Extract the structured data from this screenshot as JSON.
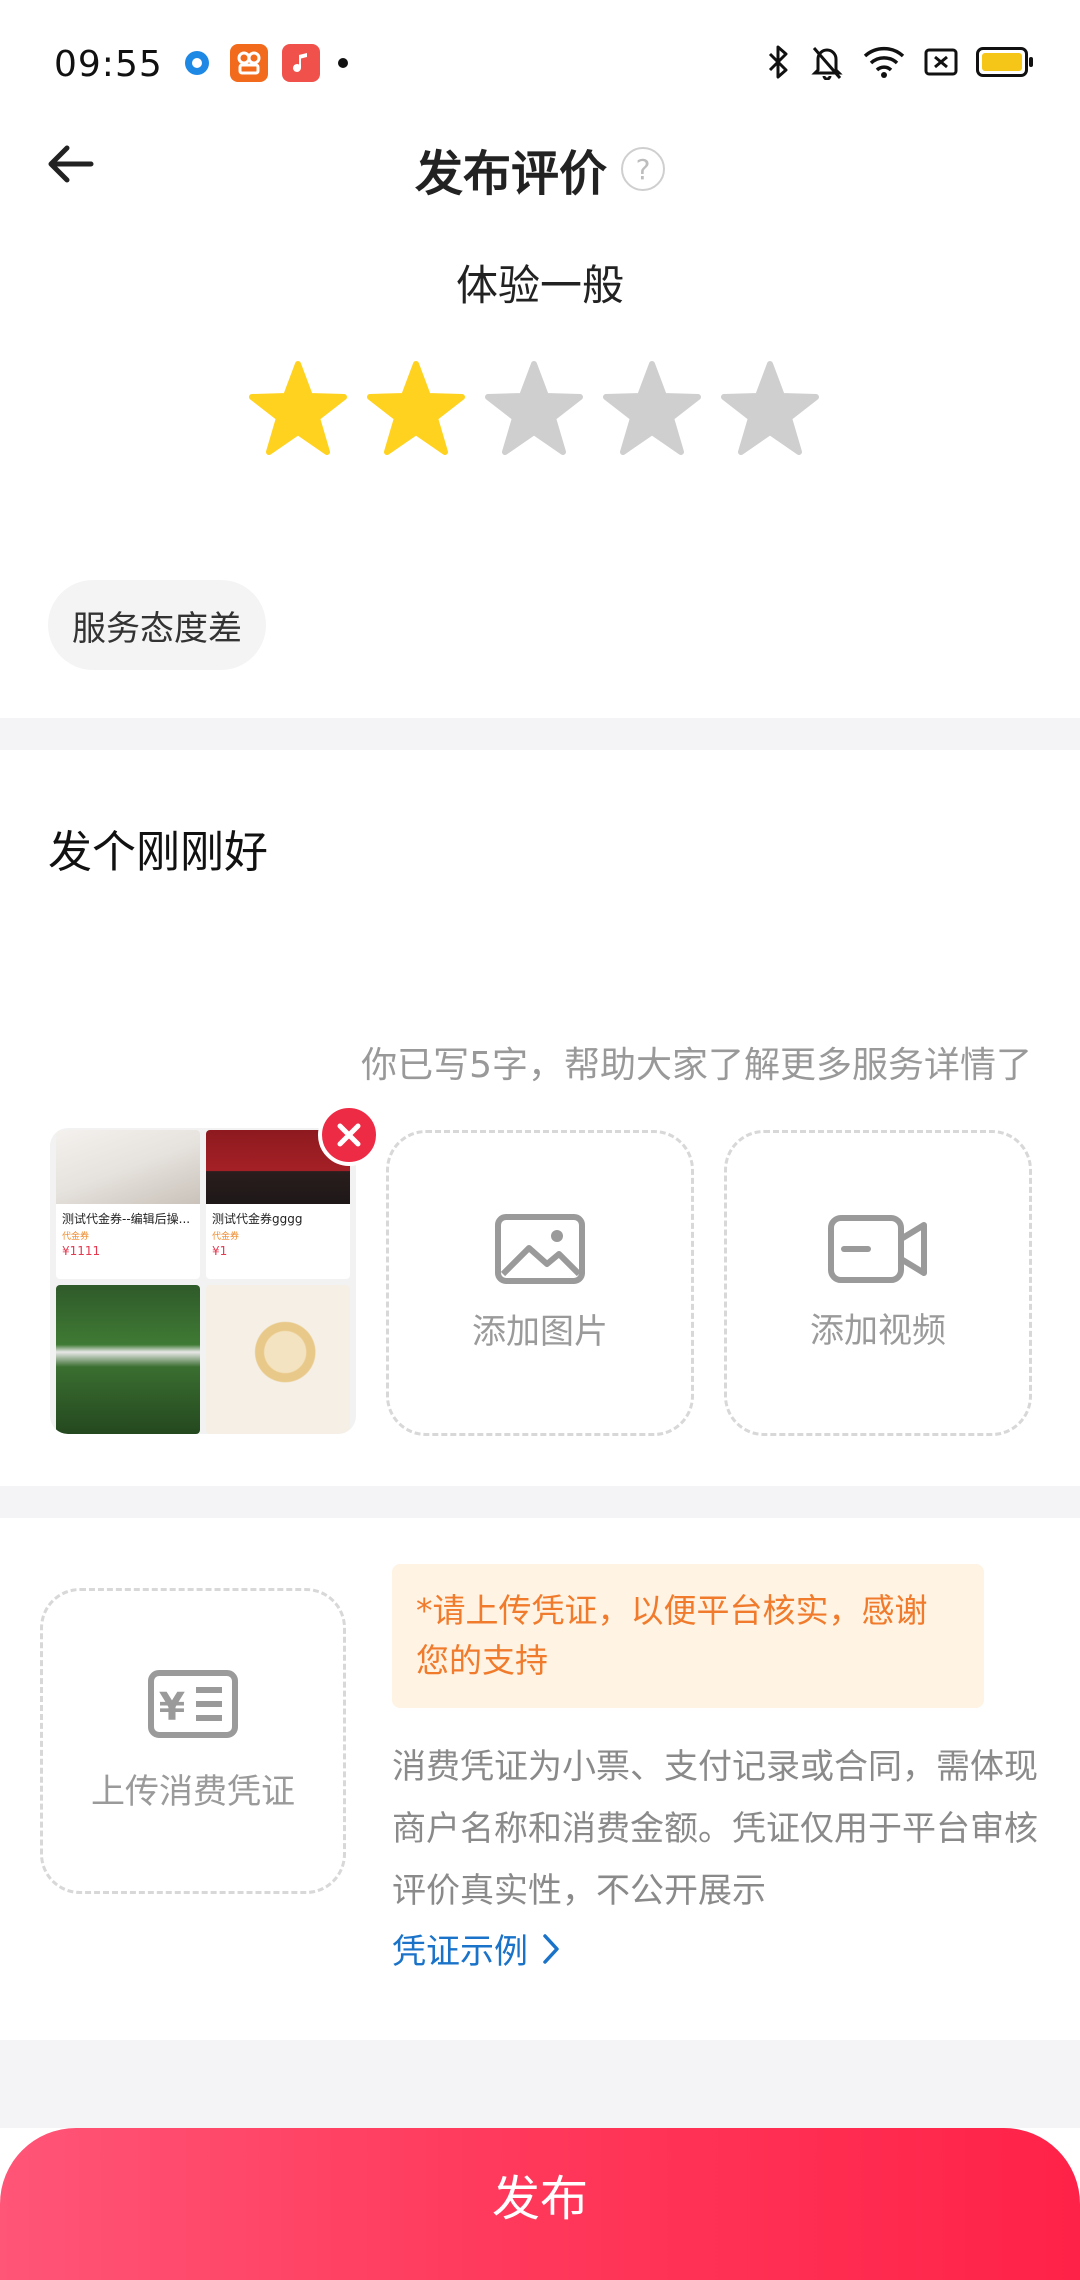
{
  "status_bar": {
    "time": "09:55"
  },
  "header": {
    "title": "发布评价",
    "help_icon": "?"
  },
  "rating": {
    "label": "体验一般",
    "value": 2,
    "max": 5,
    "filled_color": "#FFD21F",
    "empty_color": "#CFCFCF"
  },
  "tags": [
    "服务态度差"
  ],
  "review": {
    "text": "发个刚刚好",
    "hint": "你已写5字，帮助大家了解更多服务详情了"
  },
  "media": {
    "thumbnail_cards": [
      {
        "title": "测试代金券--编辑后操...",
        "sub": "代金券",
        "price": "¥1111"
      },
      {
        "title": "测试代金券gggg",
        "sub": "代金券",
        "price": "¥1"
      }
    ],
    "add_image_label": "添加图片",
    "add_video_label": "添加视频"
  },
  "receipt": {
    "upload_label": "上传消费凭证",
    "notice": "*请上传凭证，以便平台核实，感谢您的支持",
    "description": "消费凭证为小票、支付记录或合同，需体现商户名称和消费金额。凭证仅用于平台审核评价真实性，不公开展示",
    "example_link": "凭证示例"
  },
  "publish_button": "发布",
  "colors": {
    "accent": "#FF2F55",
    "notice_bg": "#FFF3E3",
    "notice_text": "#F07B2C",
    "link": "#1A73C8"
  }
}
